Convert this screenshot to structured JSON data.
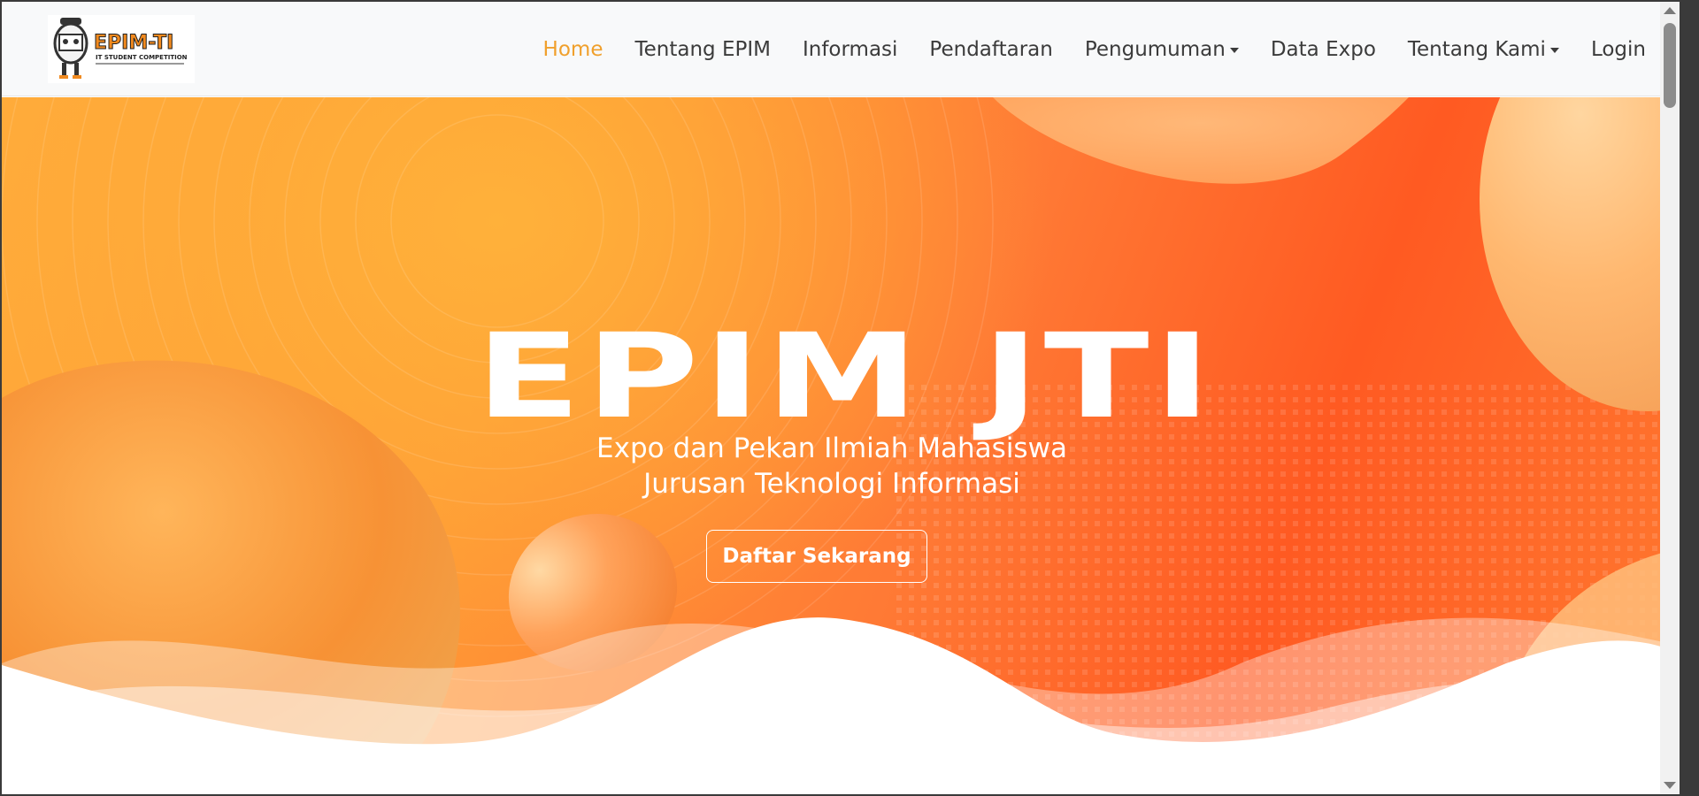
{
  "brand": {
    "logo_alt": "EPIM-TI logo",
    "logo_title": "EPIM-TI",
    "logo_tagline": "IT STUDENT COMPETITION"
  },
  "nav": {
    "home": "Home",
    "tentang_epim": "Tentang EPIM",
    "informasi": "Informasi",
    "pendaftaran": "Pendaftaran",
    "pengumuman": "Pengumuman",
    "data_expo": "Data Expo",
    "tentang_kami": "Tentang Kami",
    "login": "Login"
  },
  "hero": {
    "title": "EPIM JTI",
    "subtitle_line1": "Expo dan Pekan Ilmiah Mahasiswa",
    "subtitle_line2": "Jurusan Teknologi Informasi",
    "cta": "Daftar Sekarang"
  },
  "colors": {
    "accent": "#f0a02c",
    "hero_orange": "#ff7a35",
    "nav_text": "#3b3b3b"
  }
}
